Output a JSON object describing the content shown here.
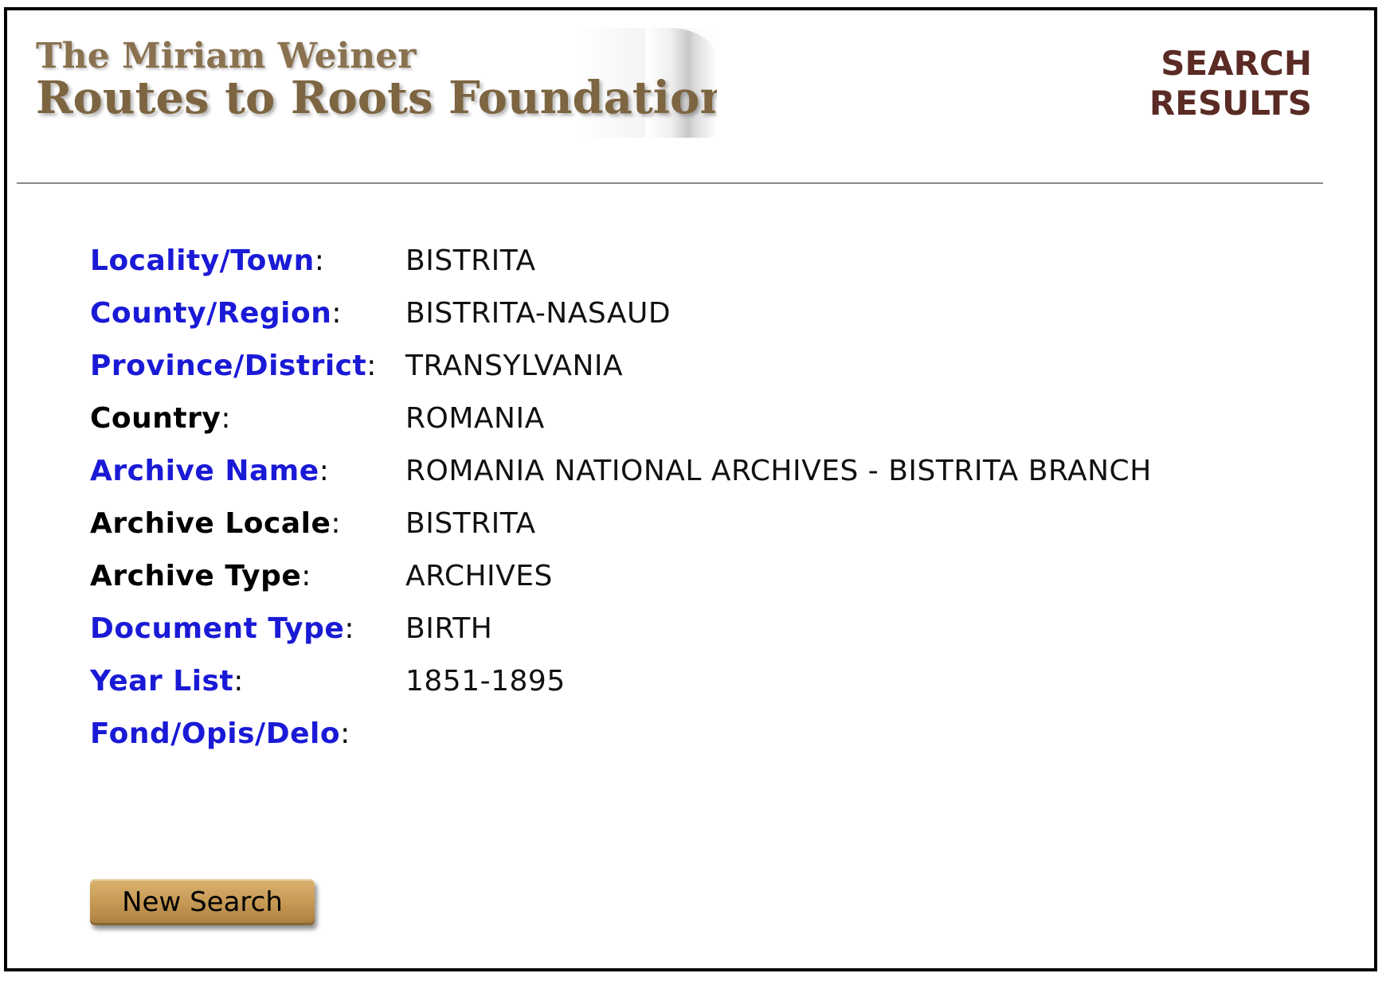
{
  "header": {
    "logo_line1": "The Miriam Weiner",
    "logo_line2": "Routes to Roots Foundation",
    "page_title_line1": "SEARCH",
    "page_title_line2": "RESULTS"
  },
  "fields": [
    {
      "label": "Locality/Town",
      "value": "BISTRITA",
      "linked": true
    },
    {
      "label": "County/Region",
      "value": "BISTRITA-NASAUD",
      "linked": true
    },
    {
      "label": "Province/District",
      "value": "TRANSYLVANIA",
      "linked": true
    },
    {
      "label": "Country",
      "value": "ROMANIA",
      "linked": false
    },
    {
      "label": "Archive Name",
      "value": "ROMANIA NATIONAL ARCHIVES - BISTRITA BRANCH",
      "linked": true
    },
    {
      "label": "Archive Locale",
      "value": "BISTRITA",
      "linked": false
    },
    {
      "label": "Archive Type",
      "value": "ARCHIVES",
      "linked": false
    },
    {
      "label": "Document Type",
      "value": "BIRTH",
      "linked": true
    },
    {
      "label": "Year List",
      "value": "1851-1895",
      "linked": true
    },
    {
      "label": "Fond/Opis/Delo",
      "value": "",
      "linked": true
    }
  ],
  "colon": ":",
  "actions": {
    "new_search_label": "New Search"
  },
  "colors": {
    "link_label": "#1a1ad6",
    "plain_label": "#000000",
    "title": "#5a2b24",
    "logo": "#7d6541",
    "button": "#c79a55"
  }
}
